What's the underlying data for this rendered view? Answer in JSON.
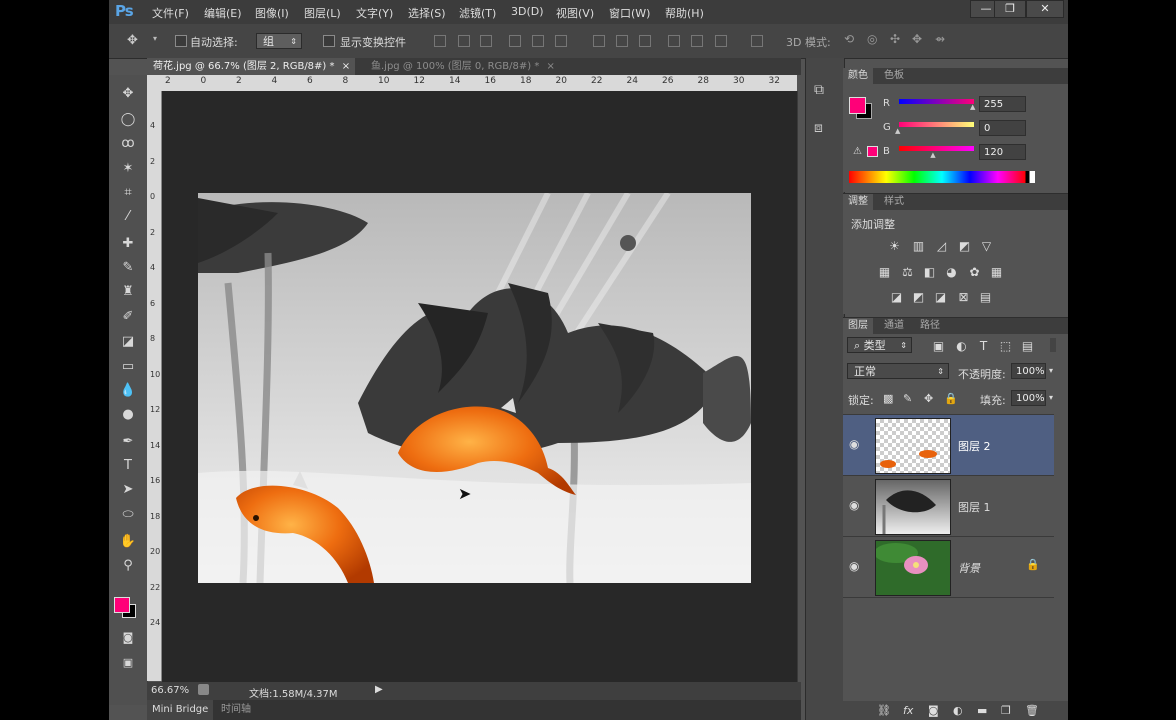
{
  "app": {
    "logo": "Ps"
  },
  "menu": [
    "文件(F)",
    "编辑(E)",
    "图像(I)",
    "图层(L)",
    "文字(Y)",
    "选择(S)",
    "滤镜(T)",
    "3D(D)",
    "视图(V)",
    "窗口(W)",
    "帮助(H)"
  ],
  "window_controls": {
    "minimize": "—",
    "restore": "❐",
    "close": "✕"
  },
  "options": {
    "auto_select_label": "自动选择:",
    "auto_select_value": "组",
    "show_transform_label": "显示变换控件",
    "mode_3d_label": "3D 模式:"
  },
  "tabs": [
    {
      "title": "荷花.jpg @ 66.7% (图层 2, RGB/8#) *",
      "close": "×"
    },
    {
      "title": "鱼.jpg @ 100% (图层 0, RGB/8#) *",
      "close": "×"
    }
  ],
  "ruler_h": [
    "2",
    "0",
    "2",
    "4",
    "6",
    "8",
    "10",
    "12",
    "14",
    "16",
    "18",
    "20",
    "22",
    "24",
    "26",
    "28",
    "30",
    "32"
  ],
  "ruler_v": [
    "4",
    "2",
    "0",
    "2",
    "4",
    "6",
    "8",
    "10",
    "12",
    "14",
    "16",
    "18",
    "20",
    "22",
    "24"
  ],
  "status": {
    "zoom": "66.67%",
    "doc": "文档:1.58M/4.37M"
  },
  "bottom_tabs": [
    "Mini Bridge",
    "时间轴"
  ],
  "color_panel": {
    "tabs": [
      "颜色",
      "色板"
    ],
    "r_label": "R",
    "g_label": "G",
    "b_label": "B",
    "r": "255",
    "g": "0",
    "b": "120",
    "fg": "#ff0078",
    "bg": "#000000",
    "r_fraction": 1.0,
    "g_fraction": 0.0,
    "b_fraction": 0.47
  },
  "adjust_panel": {
    "tabs": [
      "调整",
      "样式"
    ],
    "title": "添加调整"
  },
  "layers_panel": {
    "tabs": [
      "图层",
      "通道",
      "路径"
    ],
    "filter_label": "类型",
    "blend_mode": "正常",
    "opacity_label": "不透明度:",
    "opacity": "100%",
    "lock_label": "锁定:",
    "fill_label": "填充:",
    "fill": "100%",
    "layers": [
      {
        "name": "图层 2",
        "selected": true
      },
      {
        "name": "图层 1",
        "selected": false
      },
      {
        "name": "背景",
        "selected": false
      }
    ]
  }
}
